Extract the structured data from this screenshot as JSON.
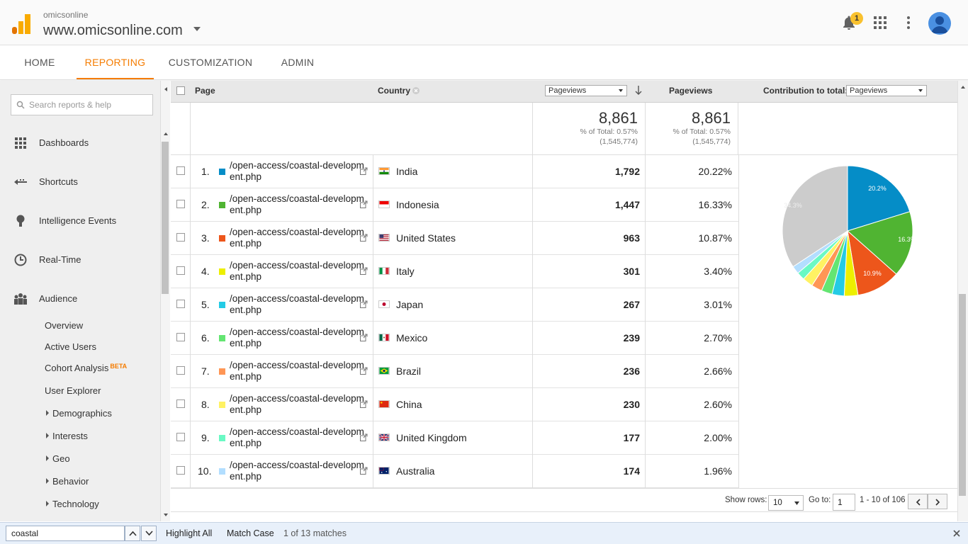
{
  "header": {
    "account_small": "omicsonline",
    "account_big": "www.omicsonline.com",
    "notification_count": "1"
  },
  "nav": {
    "tabs": [
      "HOME",
      "REPORTING",
      "CUSTOMIZATION",
      "ADMIN"
    ],
    "active": "REPORTING"
  },
  "sidebar": {
    "search_placeholder": "Search reports & help",
    "items": [
      {
        "label": "Dashboards",
        "icon": "dashboard-grid-icon"
      },
      {
        "label": "Shortcuts",
        "icon": "shortcut-arrow-icon"
      },
      {
        "label": "Intelligence Events",
        "icon": "lightbulb-icon"
      },
      {
        "label": "Real-Time",
        "icon": "clock-icon"
      },
      {
        "label": "Audience",
        "icon": "people-icon"
      }
    ],
    "subitems": [
      "Overview",
      "Active Users",
      "Cohort Analysis",
      "User Explorer"
    ],
    "beta_label": "BETA",
    "expandable": [
      "Demographics",
      "Interests",
      "Geo",
      "Behavior",
      "Technology"
    ]
  },
  "table": {
    "headers": {
      "page": "Page",
      "country": "Country",
      "metric_select": "Pageviews",
      "pageviews": "Pageviews",
      "contribution_label": "Contribution to total:",
      "contribution_select": "Pageviews"
    },
    "totals": {
      "value1": "8,861",
      "pct1": "% of Total: 0.57%",
      "of1": "(1,545,774)",
      "value2": "8,861",
      "pct2": "% of Total: 0.57%",
      "of2": "(1,545,774)"
    },
    "rows": [
      {
        "n": "1.",
        "page1": "/open-access/coastal-developm",
        "page2": "ent.php",
        "country": "India",
        "views": "1,792",
        "pct": "20.22%",
        "color": "#058dc7"
      },
      {
        "n": "2.",
        "page1": "/open-access/coastal-developm",
        "page2": "ent.php",
        "country": "Indonesia",
        "views": "1,447",
        "pct": "16.33%",
        "color": "#50b432"
      },
      {
        "n": "3.",
        "page1": "/open-access/coastal-developm",
        "page2": "ent.php",
        "country": "United States",
        "views": "963",
        "pct": "10.87%",
        "color": "#ed561b"
      },
      {
        "n": "4.",
        "page1": "/open-access/coastal-developm",
        "page2": "ent.php",
        "country": "Italy",
        "views": "301",
        "pct": "3.40%",
        "color": "#edef00"
      },
      {
        "n": "5.",
        "page1": "/open-access/coastal-developm",
        "page2": "ent.php",
        "country": "Japan",
        "views": "267",
        "pct": "3.01%",
        "color": "#24cbe5"
      },
      {
        "n": "6.",
        "page1": "/open-access/coastal-developm",
        "page2": "ent.php",
        "country": "Mexico",
        "views": "239",
        "pct": "2.70%",
        "color": "#64e572"
      },
      {
        "n": "7.",
        "page1": "/open-access/coastal-developm",
        "page2": "ent.php",
        "country": "Brazil",
        "views": "236",
        "pct": "2.66%",
        "color": "#ff9655"
      },
      {
        "n": "8.",
        "page1": "/open-access/coastal-developm",
        "page2": "ent.php",
        "country": "China",
        "views": "230",
        "pct": "2.60%",
        "color": "#fff263"
      },
      {
        "n": "9.",
        "page1": "/open-access/coastal-developm",
        "page2": "ent.php",
        "country": "United Kingdom",
        "views": "177",
        "pct": "2.00%",
        "color": "#6af9c4"
      },
      {
        "n": "10.",
        "page1": "/open-access/coastal-developm",
        "page2": "ent.php",
        "country": "Australia",
        "views": "174",
        "pct": "1.96%",
        "color": "#b2deff"
      }
    ]
  },
  "pie": {
    "labels": [
      "20.2%",
      "16.3%",
      "10.9%",
      "34.3%"
    ],
    "slices": [
      20.22,
      16.33,
      10.87,
      3.4,
      3.01,
      2.7,
      2.66,
      2.6,
      2.0,
      1.96,
      34.25
    ],
    "colors": [
      "#058dc7",
      "#50b432",
      "#ed561b",
      "#edef00",
      "#24cbe5",
      "#64e572",
      "#ff9655",
      "#fff263",
      "#6af9c4",
      "#b2deff",
      "#cccccc"
    ]
  },
  "pager": {
    "show_rows_label": "Show rows:",
    "show_rows_value": "10",
    "goto_label": "Go to:",
    "goto_value": "1",
    "range": "1 - 10 of 106"
  },
  "findbar": {
    "query": "coastal",
    "highlight_all": "Highlight All",
    "match_case": "Match Case",
    "matches": "1 of 13 matches"
  }
}
